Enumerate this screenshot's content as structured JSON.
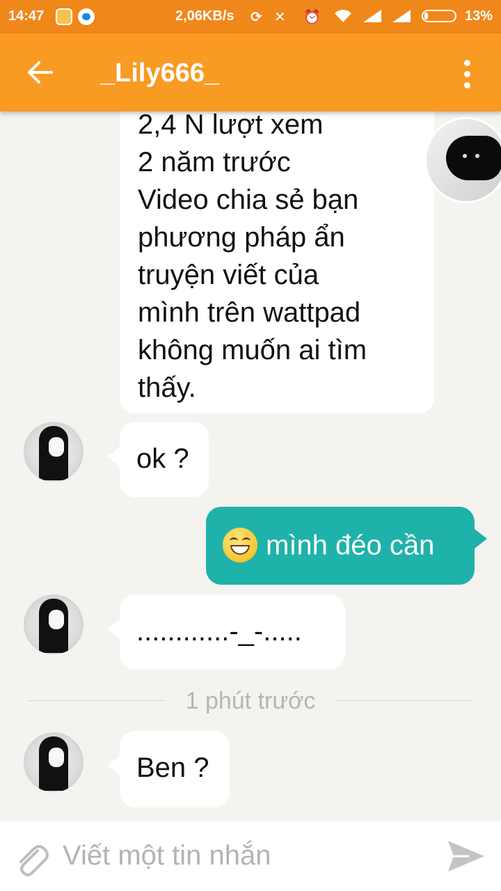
{
  "status_bar": {
    "time": "14:47",
    "network_speed": "2,06KB/s",
    "battery_percent": "13%",
    "battery_level": 0.13
  },
  "app_bar": {
    "title": "_Lily666_"
  },
  "messages": [
    {
      "sender": "me",
      "lines": [
        "2,4 N lượt xem",
        "2 năm trước",
        "Video chia sẻ bạn",
        "phương pháp ẩn",
        "truyện viết của",
        "mình trên wattpad",
        "không muốn ai tìm",
        "thấy."
      ]
    },
    {
      "sender": "other",
      "text": "ok ?"
    },
    {
      "sender": "me",
      "text": "mình đéo cần",
      "emoji": "grinning-face"
    },
    {
      "sender": "other",
      "text": "............-_-....."
    },
    {
      "sender": "other",
      "text": "Ben ?"
    }
  ],
  "timestamp": "1 phút trước",
  "composer": {
    "placeholder": "Viết một tin nhắn"
  },
  "colors": {
    "status_bar": "#f0871a",
    "app_bar": "#f99a23",
    "outgoing_bubble": "#1fb2aa",
    "incoming_bubble": "#ffffff",
    "background": "#f4f3ef"
  }
}
